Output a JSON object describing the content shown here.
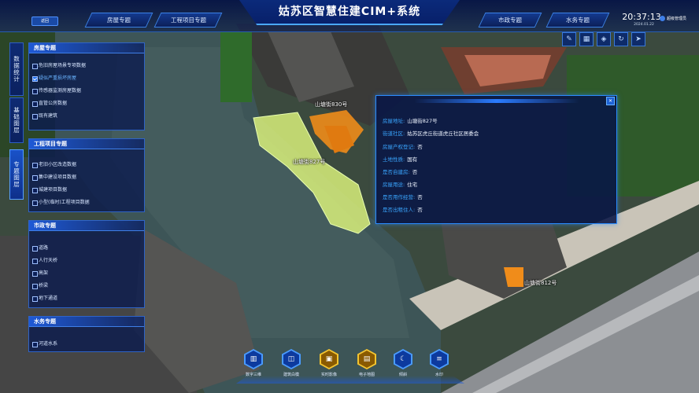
{
  "header": {
    "title": "姑苏区智慧住建CIM+系统",
    "back_label": "返回",
    "left_tabs": [
      "房屋专题",
      "工程项目专题"
    ],
    "right_tabs": [
      "市政专题",
      "水务专题"
    ],
    "time": "20:37:13",
    "date": "2024.01.22",
    "user": "超级管理员"
  },
  "toolbar": {
    "icons": [
      "pen-icon",
      "grid-icon",
      "layers-icon",
      "refresh-icon",
      "cursor-icon"
    ]
  },
  "side_tabs": [
    {
      "label": "数据统计",
      "active": false
    },
    {
      "label": "基础图层",
      "active": false
    },
    {
      "label": "专题图层",
      "active": true
    }
  ],
  "panels": [
    {
      "title": "房屋专题",
      "items": [
        {
          "label": "危旧房屋场景专项数据",
          "checked": false
        },
        {
          "label": "疑似严重损坏房屋",
          "checked": true,
          "selected": true
        },
        {
          "label": "传感器监测房屋数据",
          "checked": false
        },
        {
          "label": "直管公房数据",
          "checked": false
        },
        {
          "label": "既有建筑",
          "checked": false
        }
      ]
    },
    {
      "title": "工程项目专题",
      "items": [
        {
          "label": "老旧小区改造数据",
          "checked": false
        },
        {
          "label": "集中建设项目数据",
          "checked": false
        },
        {
          "label": "城建项目数据",
          "checked": false
        },
        {
          "label": "小型(临时)工程项目数据",
          "checked": false
        }
      ]
    },
    {
      "title": "市政专题",
      "items": [
        {
          "label": "道路",
          "checked": false
        },
        {
          "label": "人行天桥",
          "checked": false
        },
        {
          "label": "高架",
          "checked": false
        },
        {
          "label": "桥梁",
          "checked": false
        },
        {
          "label": "地下通道",
          "checked": false
        }
      ]
    },
    {
      "title": "水务专题",
      "items": [
        {
          "label": "河道水系",
          "checked": false
        }
      ]
    }
  ],
  "popup": {
    "rows": [
      {
        "key": "房屋地址:",
        "value": "山塘街827号"
      },
      {
        "key": "街道社区:",
        "value": "姑苏区虎丘街道虎丘社区居委会"
      },
      {
        "key": "房屋产权登记:",
        "value": "否"
      },
      {
        "key": "土地性质:",
        "value": "国有"
      },
      {
        "key": "是否自建房:",
        "value": "否"
      },
      {
        "key": "房屋用途:",
        "value": "住宅"
      },
      {
        "key": "是否用作经营:",
        "value": "否"
      },
      {
        "key": "是否出租住人:",
        "value": "否"
      }
    ]
  },
  "map_labels": [
    "山塘街830号",
    "山塘街827号",
    "山塘街812号"
  ],
  "bottom_nav": [
    {
      "label": "数字三维",
      "icon": "building-icon",
      "gold": false
    },
    {
      "label": "建筑白模",
      "icon": "cube-icon",
      "gold": false
    },
    {
      "label": "实时影像",
      "icon": "camera-icon",
      "gold": true
    },
    {
      "label": "电子地图",
      "icon": "map-icon",
      "gold": true
    },
    {
      "label": "倾斜",
      "icon": "moon-icon",
      "gold": false
    },
    {
      "label": "水印",
      "icon": "list-icon",
      "gold": false
    }
  ],
  "colors": {
    "accent": "#2b8cff",
    "highlight_parcel": "#d8ee7a",
    "orange_parcel": "#f08c1a",
    "gold": "#f4c430"
  }
}
